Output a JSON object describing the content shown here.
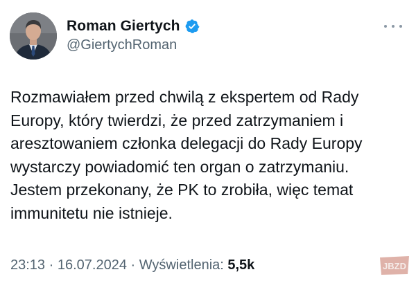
{
  "author": {
    "name": "Roman Giertych",
    "handle": "@GiertychRoman",
    "verified": true
  },
  "tweet": {
    "lines": [
      "Rozmawiałem przed chwilą z ekspertem od Rady",
      "Europy, który twierdzi, że przed zatrzymaniem i",
      "aresztowaniem członka delegacji do Rady Europy",
      "wystarczy powiadomić ten organ o zatrzymaniu.",
      "Jestem przekonany, że PK to zrobiła, więc temat",
      "immunitetu nie istnieje."
    ]
  },
  "meta": {
    "time": "23:13",
    "sep1": " · ",
    "date": "16.07.2024",
    "sep2": " · ",
    "views_label": "Wyświetlenia: ",
    "views_count": "5,5k"
  },
  "icons": {
    "verified": "verified-badge-icon",
    "more": "more-options-icon"
  },
  "colors": {
    "text_primary": "#0f1419",
    "text_secondary": "#536471",
    "verified_blue": "#1d9bf0"
  },
  "watermark": {
    "text": "JBZD"
  }
}
